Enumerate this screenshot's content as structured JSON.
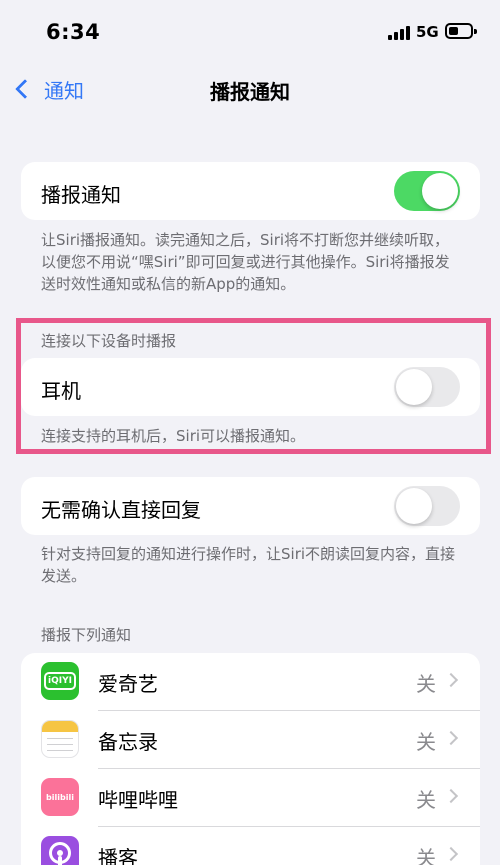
{
  "status_bar": {
    "time": "6:34",
    "network": "5G"
  },
  "nav": {
    "back_label": "通知",
    "title": "播报通知"
  },
  "announce": {
    "label": "播报通知",
    "enabled": true,
    "footnote": "让Siri播报通知。读完通知之后，Siri将不打断您并继续听取，以便您不用说“嘿Siri”即可回复或进行其他操作。Siri将播报发送时效性通知或私信的新App的通知。"
  },
  "devices": {
    "header": "连接以下设备时播报",
    "label": "耳机",
    "enabled": false,
    "footnote": "连接支持的耳机后，Siri可以播报通知。"
  },
  "reply": {
    "label": "无需确认直接回复",
    "enabled": false,
    "footnote": "针对支持回复的通知进行操作时，让Siri不朗读回复内容，直接发送。"
  },
  "apps": {
    "header": "播报下列通知",
    "items": [
      {
        "name": "爱奇艺",
        "value": "关",
        "icon": "iqiyi-icon",
        "icon_text": "iQIYI"
      },
      {
        "name": "备忘录",
        "value": "关",
        "icon": "notes-icon"
      },
      {
        "name": "哔哩哔哩",
        "value": "关",
        "icon": "bilibili-icon",
        "icon_text": "bilibili"
      },
      {
        "name": "播客",
        "value": "关",
        "icon": "podcasts-icon"
      }
    ]
  },
  "colors": {
    "accent": "#3478f6",
    "toggle_on": "#4cd964",
    "highlight": "#e8578a"
  }
}
